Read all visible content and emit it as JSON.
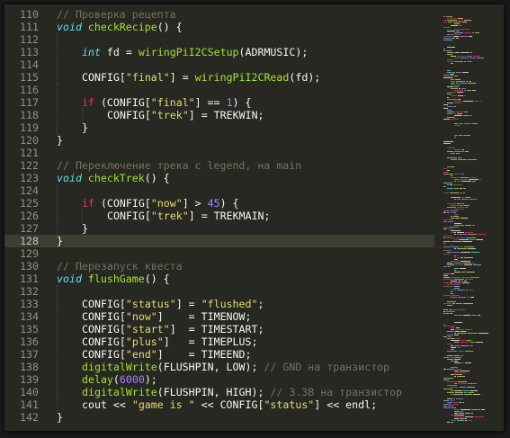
{
  "colors": {
    "background": "#272822",
    "comment": "#75715e",
    "keyword": "#f92672",
    "type": "#66d9ef",
    "function": "#a6e22e",
    "string": "#e6db74",
    "number": "#ae81ff",
    "plain": "#f8f8f2",
    "gutter": "#8f908a"
  },
  "editor": {
    "current_line": "128",
    "lines": [
      {
        "n": "110",
        "guides": 0,
        "tokens": [
          {
            "t": "// Проверка рецепта",
            "c": "cm"
          }
        ]
      },
      {
        "n": "111",
        "guides": 0,
        "tokens": [
          {
            "t": "void",
            "c": "ty"
          },
          {
            "t": " ",
            "c": "pl"
          },
          {
            "t": "checkRecipe",
            "c": "fn"
          },
          {
            "t": "() {",
            "c": "pl"
          }
        ]
      },
      {
        "n": "112",
        "guides": 1,
        "tokens": []
      },
      {
        "n": "113",
        "guides": 1,
        "tokens": [
          {
            "t": "int",
            "c": "ty"
          },
          {
            "t": " fd = ",
            "c": "pl"
          },
          {
            "t": "wiringPiI2CSetup",
            "c": "fn"
          },
          {
            "t": "(ADRMUSIC);",
            "c": "pl"
          }
        ]
      },
      {
        "n": "114",
        "guides": 1,
        "tokens": []
      },
      {
        "n": "115",
        "guides": 1,
        "tokens": [
          {
            "t": "CONFIG[",
            "c": "pl"
          },
          {
            "t": "\"final\"",
            "c": "st"
          },
          {
            "t": "] = ",
            "c": "pl"
          },
          {
            "t": "wiringPiI2CRead",
            "c": "fn"
          },
          {
            "t": "(fd);",
            "c": "pl"
          }
        ]
      },
      {
        "n": "116",
        "guides": 1,
        "tokens": []
      },
      {
        "n": "117",
        "guides": 1,
        "tokens": [
          {
            "t": "if",
            "c": "kw"
          },
          {
            "t": " (CONFIG[",
            "c": "pl"
          },
          {
            "t": "\"final\"",
            "c": "st"
          },
          {
            "t": "] == ",
            "c": "pl"
          },
          {
            "t": "1",
            "c": "nu"
          },
          {
            "t": ") {",
            "c": "pl"
          }
        ]
      },
      {
        "n": "118",
        "guides": 2,
        "tokens": [
          {
            "t": "CONFIG[",
            "c": "pl"
          },
          {
            "t": "\"trek\"",
            "c": "st"
          },
          {
            "t": "] = TREKWIN;",
            "c": "pl"
          }
        ]
      },
      {
        "n": "119",
        "guides": 1,
        "tokens": [
          {
            "t": "}",
            "c": "pl"
          }
        ]
      },
      {
        "n": "120",
        "guides": 0,
        "tokens": [
          {
            "t": "}",
            "c": "pl"
          }
        ]
      },
      {
        "n": "121",
        "guides": 0,
        "tokens": []
      },
      {
        "n": "122",
        "guides": 0,
        "tokens": [
          {
            "t": "// Переключение трека с legend, на main",
            "c": "cm"
          }
        ]
      },
      {
        "n": "123",
        "guides": 0,
        "tokens": [
          {
            "t": "void",
            "c": "ty"
          },
          {
            "t": " ",
            "c": "pl"
          },
          {
            "t": "checkTrek",
            "c": "fn"
          },
          {
            "t": "() {",
            "c": "pl"
          }
        ]
      },
      {
        "n": "124",
        "guides": 1,
        "tokens": []
      },
      {
        "n": "125",
        "guides": 1,
        "tokens": [
          {
            "t": "if",
            "c": "kw"
          },
          {
            "t": " (CONFIG[",
            "c": "pl"
          },
          {
            "t": "\"now\"",
            "c": "st"
          },
          {
            "t": "] > ",
            "c": "pl"
          },
          {
            "t": "45",
            "c": "nu"
          },
          {
            "t": ") {",
            "c": "pl"
          }
        ]
      },
      {
        "n": "126",
        "guides": 2,
        "tokens": [
          {
            "t": "CONFIG[",
            "c": "pl"
          },
          {
            "t": "\"trek\"",
            "c": "st"
          },
          {
            "t": "] = TREKMAIN;",
            "c": "pl"
          }
        ]
      },
      {
        "n": "127",
        "guides": 1,
        "tokens": [
          {
            "t": "}",
            "c": "pl"
          }
        ]
      },
      {
        "n": "128",
        "guides": 0,
        "tokens": [
          {
            "t": "}",
            "c": "pl"
          }
        ]
      },
      {
        "n": "129",
        "guides": 0,
        "tokens": []
      },
      {
        "n": "130",
        "guides": 0,
        "tokens": [
          {
            "t": "// Перезапуск квеста",
            "c": "cm"
          }
        ]
      },
      {
        "n": "131",
        "guides": 0,
        "tokens": [
          {
            "t": "void",
            "c": "ty"
          },
          {
            "t": " ",
            "c": "pl"
          },
          {
            "t": "flushGame",
            "c": "fn"
          },
          {
            "t": "() {",
            "c": "pl"
          }
        ]
      },
      {
        "n": "132",
        "guides": 1,
        "tokens": []
      },
      {
        "n": "133",
        "guides": 1,
        "tokens": [
          {
            "t": "CONFIG[",
            "c": "pl"
          },
          {
            "t": "\"status\"",
            "c": "st"
          },
          {
            "t": "] = ",
            "c": "pl"
          },
          {
            "t": "\"flushed\"",
            "c": "st"
          },
          {
            "t": ";",
            "c": "pl"
          }
        ]
      },
      {
        "n": "134",
        "guides": 1,
        "tokens": [
          {
            "t": "CONFIG[",
            "c": "pl"
          },
          {
            "t": "\"now\"",
            "c": "st"
          },
          {
            "t": "]    = TIMENOW;",
            "c": "pl"
          }
        ]
      },
      {
        "n": "135",
        "guides": 1,
        "tokens": [
          {
            "t": "CONFIG[",
            "c": "pl"
          },
          {
            "t": "\"start\"",
            "c": "st"
          },
          {
            "t": "]  = TIMESTART;",
            "c": "pl"
          }
        ]
      },
      {
        "n": "136",
        "guides": 1,
        "tokens": [
          {
            "t": "CONFIG[",
            "c": "pl"
          },
          {
            "t": "\"plus\"",
            "c": "st"
          },
          {
            "t": "]   = TIMEPLUS;",
            "c": "pl"
          }
        ]
      },
      {
        "n": "137",
        "guides": 1,
        "tokens": [
          {
            "t": "CONFIG[",
            "c": "pl"
          },
          {
            "t": "\"end\"",
            "c": "st"
          },
          {
            "t": "]    = TIMEEND;",
            "c": "pl"
          }
        ]
      },
      {
        "n": "138",
        "guides": 1,
        "tokens": [
          {
            "t": "digitalWrite",
            "c": "fn"
          },
          {
            "t": "(FLUSHPIN, LOW); ",
            "c": "pl"
          },
          {
            "t": "// GND на транзистор",
            "c": "cm"
          }
        ]
      },
      {
        "n": "139",
        "guides": 1,
        "tokens": [
          {
            "t": "delay",
            "c": "fn"
          },
          {
            "t": "(",
            "c": "pl"
          },
          {
            "t": "6000",
            "c": "nu"
          },
          {
            "t": ");",
            "c": "pl"
          }
        ]
      },
      {
        "n": "140",
        "guides": 1,
        "tokens": [
          {
            "t": "digitalWrite",
            "c": "fn"
          },
          {
            "t": "(FLUSHPIN, HIGH); ",
            "c": "pl"
          },
          {
            "t": "// 3.3В на транзистор",
            "c": "cm"
          }
        ]
      },
      {
        "n": "141",
        "guides": 1,
        "tokens": [
          {
            "t": "cout << ",
            "c": "pl"
          },
          {
            "t": "\"game is \"",
            "c": "st"
          },
          {
            "t": " << CONFIG[",
            "c": "pl"
          },
          {
            "t": "\"status\"",
            "c": "st"
          },
          {
            "t": "] << endl;",
            "c": "pl"
          }
        ]
      },
      {
        "n": "142",
        "guides": 0,
        "tokens": [
          {
            "t": "}",
            "c": "pl"
          }
        ]
      }
    ]
  }
}
